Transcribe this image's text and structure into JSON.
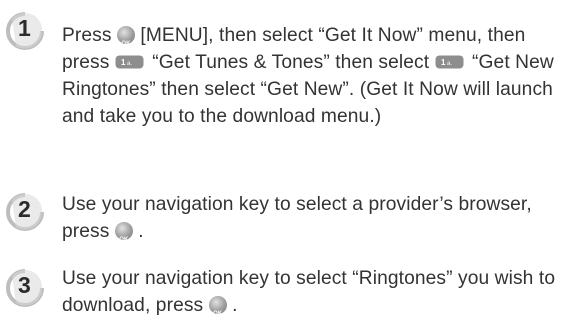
{
  "steps": [
    {
      "number": "1",
      "parts": [
        "Press",
        "[MENU], then select “Get It Now” menu, then press",
        "“Get Tunes & Tones” then select",
        "“Get New Ringtones” then select “Get New”. (Get It Now will launch and take you to the download menu.)"
      ]
    },
    {
      "number": "2",
      "parts": [
        "Use your navigation key to select a provider’s browser, press",
        "."
      ]
    },
    {
      "number": "3",
      "parts": [
        "Use your navigation key to select “Ringtones” you wish to download, press",
        "."
      ]
    }
  ],
  "icons": {
    "ok_key": "ok-key-icon",
    "one_key": "key-1-icon"
  }
}
